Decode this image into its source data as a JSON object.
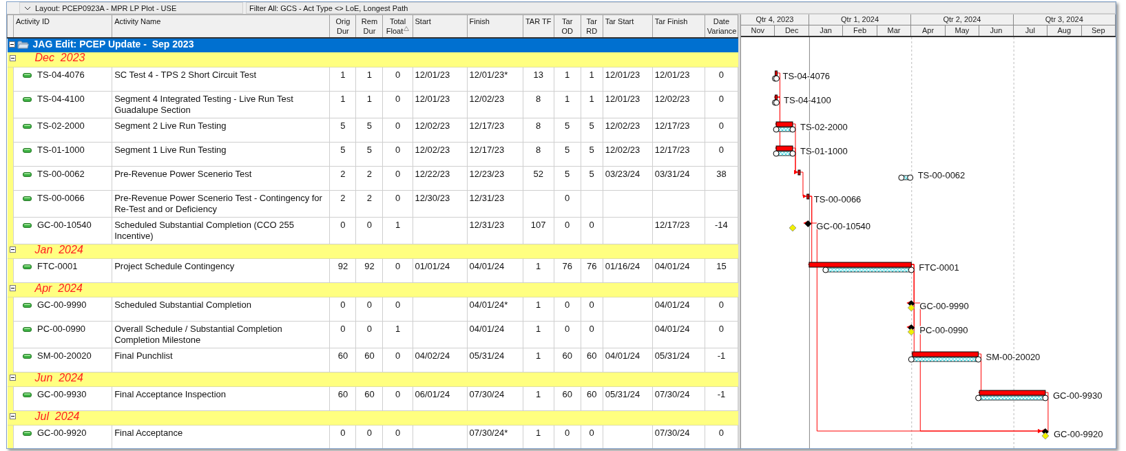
{
  "toolbar": {
    "layout": "Layout: PCEP0923A - MPR LP Plot - USE",
    "filter": "Filter All: GCS - Act Type <> LoE, Longest Path"
  },
  "table": {
    "columns": [
      {
        "label": "Activity ID",
        "sorted": false
      },
      {
        "label": "Activity Name",
        "sorted": false
      },
      {
        "label": "Orig Dur",
        "sorted": false
      },
      {
        "label": "Rem Dur",
        "sorted": false
      },
      {
        "label": "Total Float",
        "sorted": true
      },
      {
        "label": "Start",
        "sorted": false
      },
      {
        "label": "Finish",
        "sorted": false
      },
      {
        "label": "TAR TF",
        "sorted": false
      },
      {
        "label": "Tar OD",
        "sorted": false
      },
      {
        "label": "Tar RD",
        "sorted": false
      },
      {
        "label": "Tar Start",
        "sorted": false
      },
      {
        "label": "Tar Finish",
        "sorted": false
      },
      {
        "label": "Date Variance",
        "sorted": false
      }
    ],
    "root": {
      "label": "JAG Edit: PCEP Update -  Sep 2023",
      "expanded": true
    },
    "groups": [
      {
        "label": "Dec  2023",
        "expanded": true,
        "rows": [
          {
            "id": "TS-04-4076",
            "name": "SC Test 4 - TPS 2 Short Circuit Test",
            "orig_dur": "1",
            "rem_dur": "1",
            "total_float": "0",
            "start": "12/01/23",
            "finish": "12/01/23*",
            "tar_tf": "13",
            "tar_od": "1",
            "tar_rd": "1",
            "tar_start": "12/01/23",
            "tar_finish": "12/01/23",
            "date_variance": "0"
          },
          {
            "id": "TS-04-4100",
            "name": "Segment 4 Integrated Testing - Live Run Test Guadalupe Section",
            "orig_dur": "1",
            "rem_dur": "1",
            "total_float": "0",
            "start": "12/01/23",
            "finish": "12/02/23",
            "tar_tf": "8",
            "tar_od": "1",
            "tar_rd": "1",
            "tar_start": "12/01/23",
            "tar_finish": "12/02/23",
            "date_variance": "0"
          },
          {
            "id": "TS-02-2000",
            "name": "Segment 2 Live Run Testing",
            "orig_dur": "5",
            "rem_dur": "5",
            "total_float": "0",
            "start": "12/02/23",
            "finish": "12/17/23",
            "tar_tf": "8",
            "tar_od": "5",
            "tar_rd": "5",
            "tar_start": "12/02/23",
            "tar_finish": "12/17/23",
            "date_variance": "0"
          },
          {
            "id": "TS-01-1000",
            "name": "Segment 1 Live Run Testing",
            "orig_dur": "5",
            "rem_dur": "5",
            "total_float": "0",
            "start": "12/02/23",
            "finish": "12/17/23",
            "tar_tf": "8",
            "tar_od": "5",
            "tar_rd": "5",
            "tar_start": "12/02/23",
            "tar_finish": "12/17/23",
            "date_variance": "0"
          },
          {
            "id": "TS-00-0062",
            "name": "Pre-Revenue Power Scenerio Test",
            "orig_dur": "2",
            "rem_dur": "2",
            "total_float": "0",
            "start": "12/22/23",
            "finish": "12/23/23",
            "tar_tf": "52",
            "tar_od": "5",
            "tar_rd": "5",
            "tar_start": "03/23/24",
            "tar_finish": "03/31/24",
            "date_variance": "38"
          },
          {
            "id": "TS-00-0066",
            "name": "Pre-Revenue Power Scenerio Test - Contingency for Re-Test and or Deficiency",
            "orig_dur": "2",
            "rem_dur": "2",
            "total_float": "0",
            "start": "12/30/23",
            "finish": "12/31/23",
            "tar_od": "0"
          },
          {
            "id": "GC-00-10540",
            "name": "Scheduled Substantial Completion (CCO 255 Incentive)",
            "orig_dur": "0",
            "rem_dur": "0",
            "total_float": "1",
            "finish": "12/31/23",
            "tar_tf": "107",
            "tar_od": "0",
            "tar_rd": "0",
            "tar_finish": "12/17/23",
            "date_variance": "-14"
          }
        ]
      },
      {
        "label": "Jan  2024",
        "expanded": true,
        "rows": [
          {
            "id": "FTC-0001",
            "name": "Project Schedule Contingency",
            "orig_dur": "92",
            "rem_dur": "92",
            "total_float": "0",
            "start": "01/01/24",
            "finish": "04/01/24",
            "tar_tf": "1",
            "tar_od": "76",
            "tar_rd": "76",
            "tar_start": "01/16/24",
            "tar_finish": "04/01/24",
            "date_variance": "15"
          }
        ]
      },
      {
        "label": "Apr  2024",
        "expanded": true,
        "rows": [
          {
            "id": "GC-00-9990",
            "name": "Scheduled Substantial Completion",
            "orig_dur": "0",
            "rem_dur": "0",
            "total_float": "0",
            "finish": "04/01/24*",
            "tar_tf": "1",
            "tar_od": "0",
            "tar_rd": "0",
            "tar_finish": "04/01/24",
            "date_variance": "0"
          },
          {
            "id": "PC-00-0990",
            "name": "Overall Schedule / Substantial Completion Completion Milestone",
            "orig_dur": "0",
            "rem_dur": "0",
            "total_float": "1",
            "finish": "04/01/24",
            "tar_tf": "1",
            "tar_od": "0",
            "tar_rd": "0",
            "tar_finish": "04/01/24",
            "date_variance": "0"
          },
          {
            "id": "SM-00-20020",
            "name": "Final Punchlist",
            "orig_dur": "60",
            "rem_dur": "60",
            "total_float": "0",
            "start": "04/02/24",
            "finish": "05/31/24",
            "tar_tf": "1",
            "tar_od": "60",
            "tar_rd": "60",
            "tar_start": "04/01/24",
            "tar_finish": "05/31/24",
            "date_variance": "-1"
          }
        ]
      },
      {
        "label": "Jun  2024",
        "expanded": true,
        "rows": [
          {
            "id": "GC-00-9930",
            "name": "Final Acceptance Inspection",
            "orig_dur": "60",
            "rem_dur": "60",
            "total_float": "0",
            "start": "06/01/24",
            "finish": "07/30/24",
            "tar_tf": "1",
            "tar_od": "60",
            "tar_rd": "60",
            "tar_start": "05/31/24",
            "tar_finish": "07/30/24",
            "date_variance": "-1"
          }
        ]
      },
      {
        "label": "Jul  2024",
        "expanded": true,
        "rows": [
          {
            "id": "GC-00-9920",
            "name": "Final Acceptance",
            "orig_dur": "0",
            "rem_dur": "0",
            "total_float": "0",
            "finish": "07/30/24*",
            "tar_tf": "1",
            "tar_od": "0",
            "tar_rd": "0",
            "tar_finish": "07/30/24",
            "date_variance": "0"
          }
        ]
      }
    ]
  },
  "gantt": {
    "quarters": [
      {
        "label": "Qtr 4, 2023",
        "months": [
          "Nov",
          "Dec"
        ]
      },
      {
        "label": "Qtr 1, 2024",
        "months": [
          "Jan",
          "Feb",
          "Mar"
        ]
      },
      {
        "label": "Qtr 2, 2024",
        "months": [
          "Apr",
          "May",
          "Jun"
        ]
      },
      {
        "label": "Qtr 3, 2024",
        "months": [
          "Jul",
          "Aug",
          "Sep"
        ]
      }
    ],
    "bars": [
      {
        "label": "TS-04-4076",
        "kind": "task"
      },
      {
        "label": "TS-04-4100",
        "kind": "task"
      },
      {
        "label": "TS-02-2000",
        "kind": "task"
      },
      {
        "label": "TS-01-1000",
        "kind": "task"
      },
      {
        "label": "TS-00-0062",
        "kind": "task"
      },
      {
        "label": "TS-00-0066",
        "kind": "task"
      },
      {
        "label": "GC-00-10540",
        "kind": "milestone"
      },
      {
        "label": "FTC-0001",
        "kind": "task"
      },
      {
        "label": "GC-00-9990",
        "kind": "milestone"
      },
      {
        "label": "PC-00-0990",
        "kind": "milestone"
      },
      {
        "label": "SM-00-20020",
        "kind": "task"
      },
      {
        "label": "GC-00-9930",
        "kind": "task"
      },
      {
        "label": "GC-00-9920",
        "kind": "milestone"
      }
    ]
  }
}
